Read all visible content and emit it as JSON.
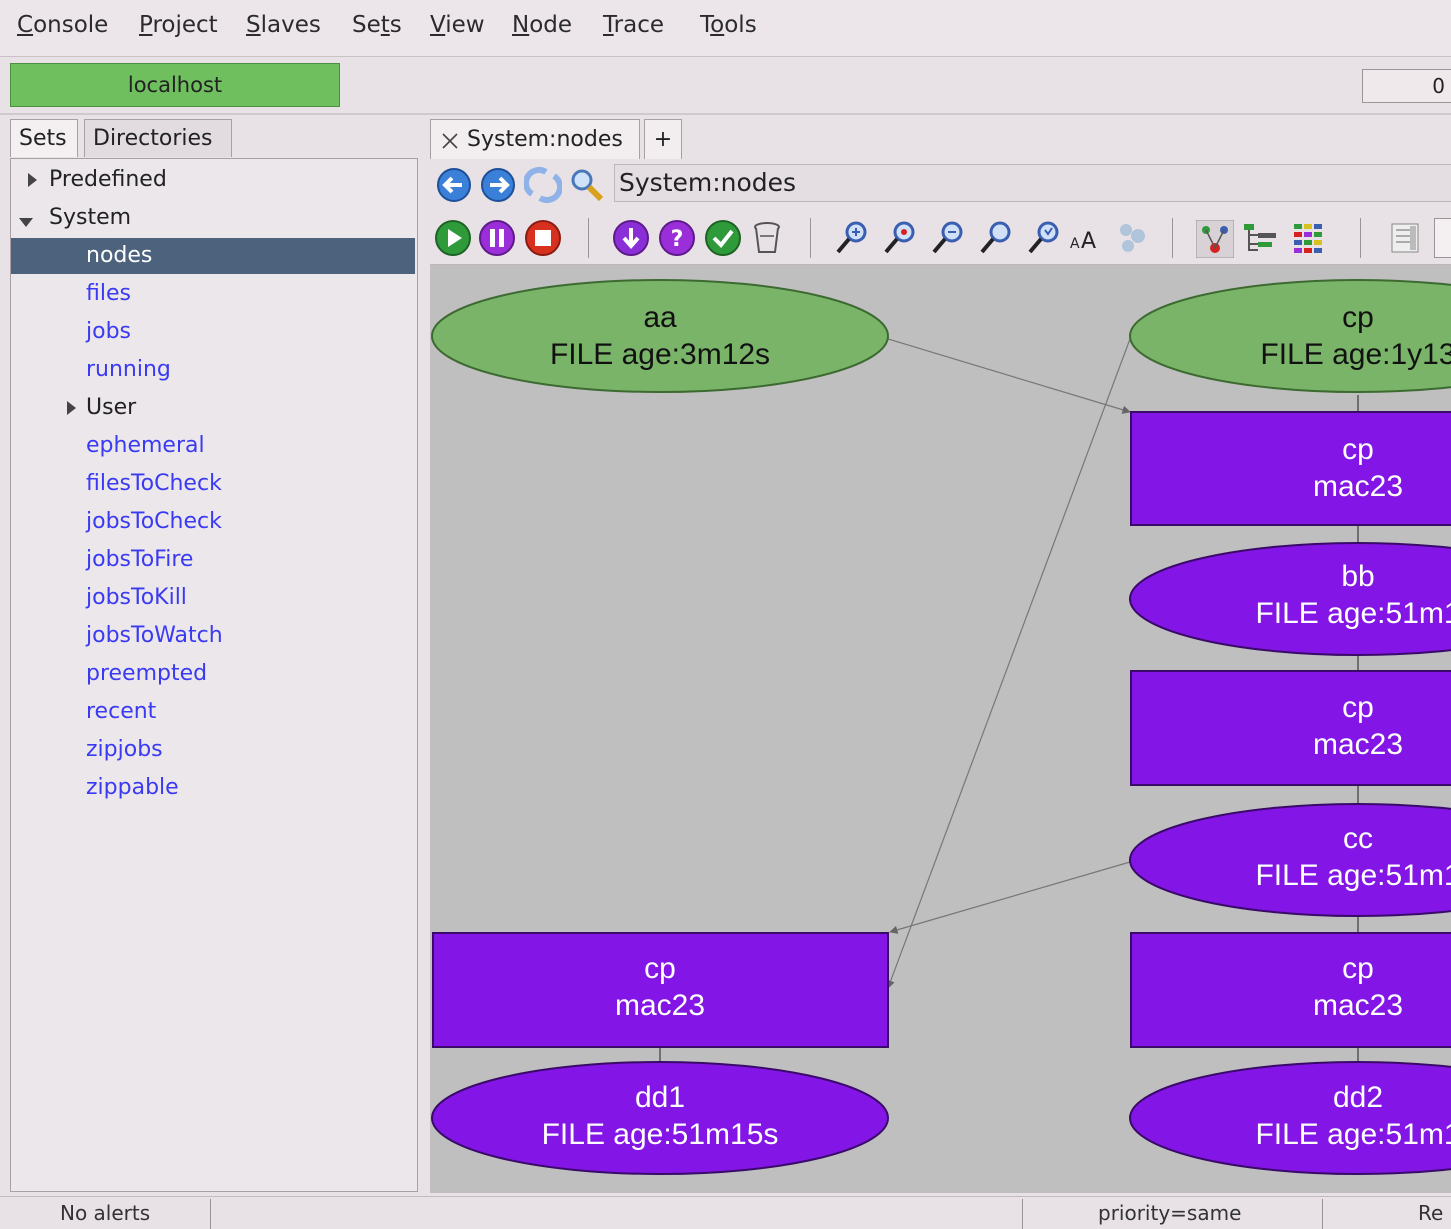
{
  "menu": {
    "items": [
      {
        "label": "Console",
        "ul": "C",
        "rest": "onsole"
      },
      {
        "label": "Project",
        "ul": "P",
        "rest": "roject"
      },
      {
        "label": "Slaves",
        "ul": "S",
        "rest": "laves"
      },
      {
        "label": "Sets",
        "ul": "S",
        "rest": "ets",
        "ul_index": 2
      },
      {
        "label": "View",
        "ul": "V",
        "rest": "iew"
      },
      {
        "label": "Node",
        "ul": "N",
        "rest": "ode"
      },
      {
        "label": "Trace",
        "ul": "T",
        "rest": "race"
      },
      {
        "label": "Tools",
        "ul": "o",
        "rest": "ols",
        "pre": "T"
      }
    ]
  },
  "host": {
    "label": "localhost",
    "color": "#6fbf5f",
    "counter": "0"
  },
  "left_tabs": {
    "sets": "Sets",
    "directories": "Directories"
  },
  "tree": {
    "predefined": "Predefined",
    "system": "System",
    "items": [
      "nodes",
      "files",
      "jobs",
      "running"
    ],
    "user": "User",
    "items2": [
      "ephemeral",
      "filesToCheck",
      "jobsToCheck",
      "jobsToFire",
      "jobsToKill",
      "jobsToWatch",
      "preempted",
      "recent",
      "zipjobs",
      "zippable"
    ],
    "selected": "nodes"
  },
  "right_tabs": {
    "active": "System:nodes",
    "add": "+"
  },
  "address": "System:nodes",
  "graph": {
    "nodes": [
      {
        "id": "aa",
        "shape": "ellipse",
        "color": "green",
        "line1": "aa",
        "line2": "FILE age:3m12s"
      },
      {
        "id": "cp-top",
        "shape": "ellipse",
        "color": "green",
        "line1": "cp",
        "line2": "FILE age:1y13"
      },
      {
        "id": "cp-r1",
        "shape": "box",
        "color": "purple",
        "line1": "cp",
        "line2": "mac23"
      },
      {
        "id": "bb",
        "shape": "ellipse",
        "color": "purple",
        "line1": "bb",
        "line2": "FILE age:51m1"
      },
      {
        "id": "cp-r2",
        "shape": "box",
        "color": "purple",
        "line1": "cp",
        "line2": "mac23"
      },
      {
        "id": "cc",
        "shape": "ellipse",
        "color": "purple",
        "line1": "cc",
        "line2": "FILE age:51m1"
      },
      {
        "id": "cp-left",
        "shape": "box",
        "color": "purple",
        "line1": "cp",
        "line2": "mac23"
      },
      {
        "id": "cp-r3",
        "shape": "box",
        "color": "purple",
        "line1": "cp",
        "line2": "mac23"
      },
      {
        "id": "dd1",
        "shape": "ellipse",
        "color": "purple",
        "line1": "dd1",
        "line2": "FILE age:51m15s"
      },
      {
        "id": "dd2",
        "shape": "ellipse",
        "color": "purple",
        "line1": "dd2",
        "line2": "FILE age:51m1"
      }
    ]
  },
  "status": {
    "alerts": "No alerts",
    "priority": "priority=same",
    "right": "Re"
  },
  "colors": {
    "green_node": "#7ab469",
    "purple_node": "#8316e6",
    "canvas": "#bfbfbf",
    "selection": "#4d627c"
  },
  "icons": [
    "back-icon",
    "forward-icon",
    "refresh-icon",
    "search-icon",
    "play-icon",
    "pause-icon",
    "stop-icon",
    "download-icon",
    "help-icon",
    "check-icon",
    "trash-icon",
    "zoom-in-icon",
    "zoom-in-alt-icon",
    "zoom-out-icon",
    "zoom-fit-icon",
    "zoom-reset-icon",
    "font-size-icon",
    "settings-icon",
    "graph-layout-icon",
    "tree-layout-icon",
    "grid-layout-icon",
    "panel-icon"
  ]
}
